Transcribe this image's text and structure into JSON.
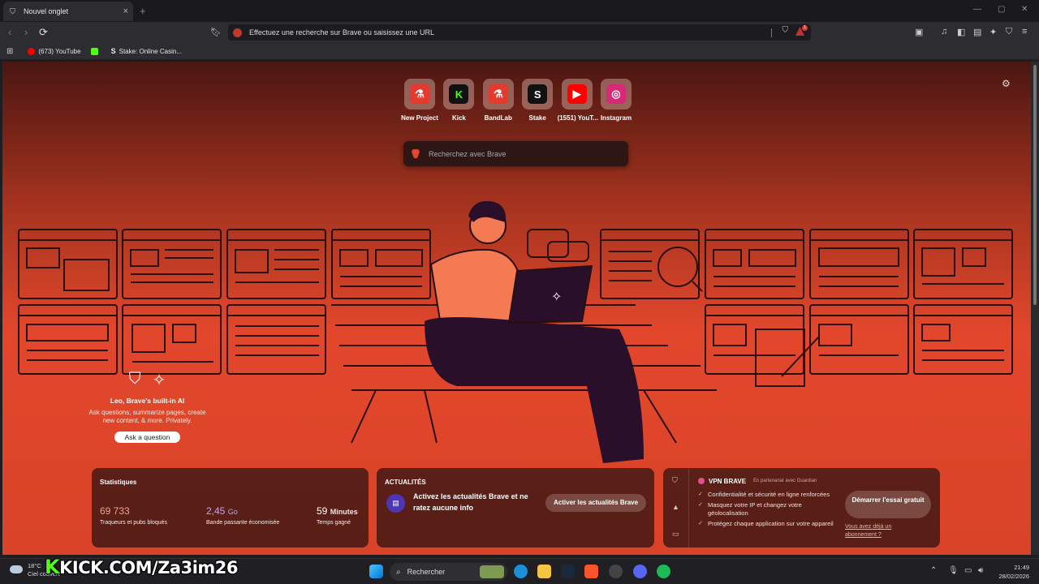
{
  "tab": {
    "title": "Nouvel onglet",
    "new_tab": "+",
    "close": "×"
  },
  "window": {
    "minimize": "—",
    "maximize": "▢",
    "close": "✕"
  },
  "toolbar": {
    "back": "‹",
    "forward": "›",
    "reload": "⟳",
    "address_placeholder": "Effectuez une recherche sur Brave ou saisissez une URL",
    "rewards_badge": "1"
  },
  "bookmarks": [
    {
      "label": "",
      "icon": "apps-icon",
      "color": "#cccccc"
    },
    {
      "label": "(673) YouTube",
      "icon": "youtube-icon",
      "color": "#ff0000"
    },
    {
      "label": "",
      "icon": "kick-icon",
      "color": "#53fc18"
    },
    {
      "label": "Stake: Online Casin...",
      "icon": "stake-icon",
      "color": "#ffffff"
    }
  ],
  "top_sites": [
    {
      "label": "New Project",
      "glyph": "⚗",
      "bg": "#e63a2f",
      "fg": "#ffffff"
    },
    {
      "label": "Kick",
      "glyph": "K",
      "bg": "#111111",
      "fg": "#53fc18"
    },
    {
      "label": "BandLab",
      "glyph": "⚗",
      "bg": "#e63a2f",
      "fg": "#ffffff"
    },
    {
      "label": "Stake",
      "glyph": "S",
      "bg": "#111111",
      "fg": "#ffffff"
    },
    {
      "label": "(1551) YouT...",
      "glyph": "▶",
      "bg": "#ff0000",
      "fg": "#ffffff"
    },
    {
      "label": "Instagram",
      "glyph": "◎",
      "bg": "#d62976",
      "fg": "#ffffff"
    }
  ],
  "search": {
    "placeholder": "Recherchez avec Brave"
  },
  "leo": {
    "title": "Leo, Brave's built-in AI",
    "description": "Ask questions, summarize pages, create new content, & more. Privately.",
    "button": "Ask a question"
  },
  "stats": {
    "title": "Statistiques",
    "items": [
      {
        "value": "69 733",
        "unit": "",
        "label": "Traqueurs et pubs bloqués",
        "color": "#f0a090"
      },
      {
        "value": "2,45",
        "unit": "Go",
        "label": "Bande passante économisée",
        "color": "#b8a6f5"
      },
      {
        "value": "59",
        "unit": "Minutes",
        "label": "Temps gagné",
        "color": "#ffffff"
      }
    ]
  },
  "news": {
    "title": "ACTUALITÉS",
    "text": "Activez les actualités Brave et ne ratez aucune info",
    "button": "Activer les actualités Brave"
  },
  "vpn": {
    "title": "VPN BRAVE",
    "partner": "En partenariat avec  Guardian",
    "features": [
      "Confidentialité et sécurité en ligne renforcées",
      "Masquez votre IP et changez votre géolocalisation",
      "Protégez chaque application sur votre appareil"
    ],
    "cta": "Démarrer l'essai gratuit",
    "subscribed": "Vous avez déjà un abonnement ?"
  },
  "taskbar": {
    "temperature": "18°C",
    "weather": "Ciel couvert",
    "overlay": "KICK.COM/Za3im26",
    "search": "Rechercher",
    "time": "21:49",
    "date": "28/02/2026"
  }
}
